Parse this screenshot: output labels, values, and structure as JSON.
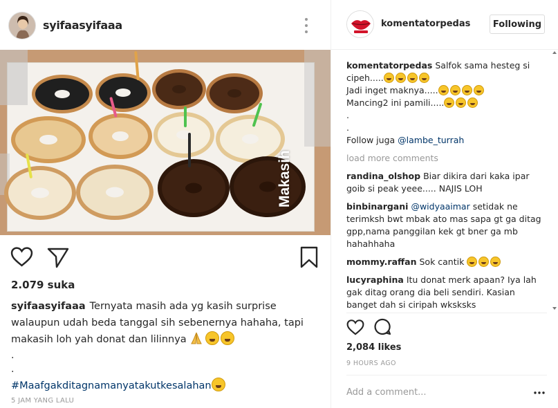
{
  "left_post": {
    "username": "syifaasyifaaa",
    "photo_watermark": "Makasih",
    "likes": "2.079 suka",
    "caption_user": "syifaasyifaaa",
    "caption_text": "Ternyata masih ada yg kasih surprise walaupun udah beda tanggal sih sebenernya hahaha, tapi makasih loh yah  donat dan lilinnya",
    "caption_dot_1": ".",
    "caption_dot_2": ".",
    "hashtag": "#Maafgakditagnamanyatakutkesalahan",
    "time": "5 JAM YANG LALU",
    "icons": [
      "more-vertical-icon",
      "heart-icon",
      "share-icon",
      "bookmark-icon"
    ]
  },
  "right_panel": {
    "username": "komentatorpedas",
    "follow_label": "Following",
    "owner_comment": {
      "user": "komentatorpedas",
      "line1": "Salfok sama hesteg si cipeh.....",
      "line2": "Jadi inget maknya.....",
      "line3": "Mancing2 ini pamili.....",
      "dot1": ".",
      "dot2": ".",
      "follow_text": "Follow juga ",
      "follow_link": "@lambe_turrah"
    },
    "load_more": "load more comments",
    "comments": [
      {
        "user": "randina_olshop",
        "text": "Biar dikira dari kaka ipar goib si peak yeee..... NAJIS LOH"
      },
      {
        "user": "binbinargani",
        "mention": "@widyaaimar",
        "text": " setidak ne terimksh bwt mbak ato mas sapa gt ga ditag gpp,nama panggilan kek gt bner ga mb hahahhaha"
      },
      {
        "user": "mommy.raffan",
        "text": "Sok cantik"
      },
      {
        "user": "lucyraphina",
        "text": "Itu donat merk apaan? Iya lah gak ditag orang dia beli sendiri. Kasian banget dah si ciripah wksksks"
      }
    ],
    "likes": "2,084 likes",
    "time": "9 HOURS AGO",
    "add_comment_placeholder": "Add a comment...",
    "more_label": "•••",
    "icons": [
      "heart-icon",
      "comment-icon"
    ]
  }
}
